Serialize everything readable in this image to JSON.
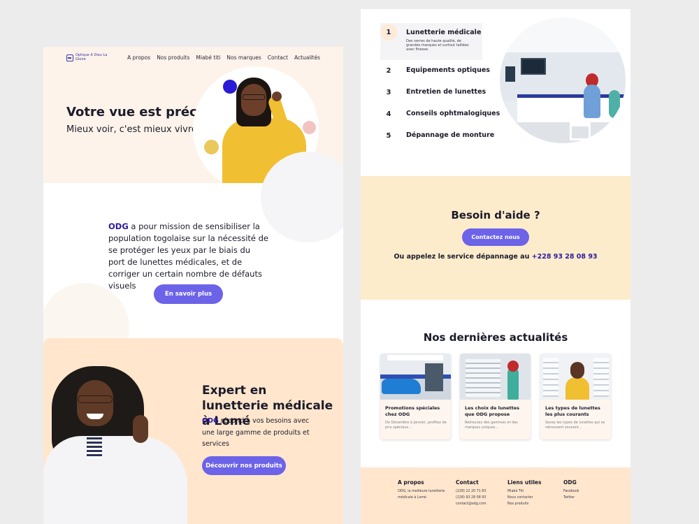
{
  "nav": {
    "logo_text": "Optique A Dieu La Gloire",
    "links": [
      "A propos",
      "Nos produits",
      "Miabé titi",
      "Nos marques",
      "Contact",
      "Actualités"
    ]
  },
  "hero": {
    "title": "Votre vue est précieuse",
    "subtitle": "Mieux voir, c'est mieux vivre"
  },
  "mission": {
    "brand": "ODG",
    "text": " a pour mission de sensibiliser la population togolaise sur la nécessité de se protéger les yeux par le biais du port de lunettes médicales, et de corriger un certain nombre de défauts visuels",
    "button": "En savoir plus"
  },
  "expert": {
    "title": "Expert en lunetterie médicale à Lomé",
    "brand": "ODG",
    "text": " répond à vos besoins avec une large gamme de produits et services",
    "button": "Découvrir nos produits"
  },
  "services": [
    {
      "num": "1",
      "label": "Lunetterie médicale",
      "desc": "Des verres de haute qualité, de grandes marques et surtout taillées avec finesse."
    },
    {
      "num": "2",
      "label": "Equipements optiques"
    },
    {
      "num": "3",
      "label": "Entretien de lunettes"
    },
    {
      "num": "4",
      "label": "Conseils ophtmalogiques"
    },
    {
      "num": "5",
      "label": "Dépannage de monture"
    }
  ],
  "help": {
    "title": "Besoin d'aide ?",
    "button": "Contactez nous",
    "phone_text": "Ou appelez le service dépannage au ",
    "phone_number": "+228 93 28 08 93"
  },
  "news": {
    "title": "Nos dernières actualités",
    "cards": [
      {
        "title": "Promotions spéciales chez ODG",
        "text": "De Décembre à Janvier, profitez de prix spéciaux..."
      },
      {
        "title": "Les choix de lunettes que ODG propose",
        "text": "Retrouvez des gammes et des marques uniques..."
      },
      {
        "title": "Les types de lunettes les plus courants",
        "text": "Savez les types de lunettes qui se retrouvent souvent..."
      }
    ]
  },
  "footer": {
    "col1": {
      "title": "A propos",
      "lines": [
        "ODG, la meilleure lunetterie",
        "médicale à Lomé"
      ]
    },
    "col2": {
      "title": "Contact",
      "lines": [
        "(228) 22 20 71 83",
        "(228) 93 28 08 93",
        "contact@odg.com"
      ]
    },
    "col3": {
      "title": "Liens utiles",
      "lines": [
        "Miabé Titi",
        "Nous contacter",
        "Nos produits"
      ]
    },
    "col4": {
      "title": "ODG",
      "lines": [
        "Facebook",
        "Twitter"
      ]
    }
  },
  "colors": {
    "accent": "#6c63e8",
    "brand": "#2a1aa0",
    "hero_bg": "#fdf3ea",
    "peach": "#ffe6cd",
    "help_bg": "#fdeccc"
  }
}
